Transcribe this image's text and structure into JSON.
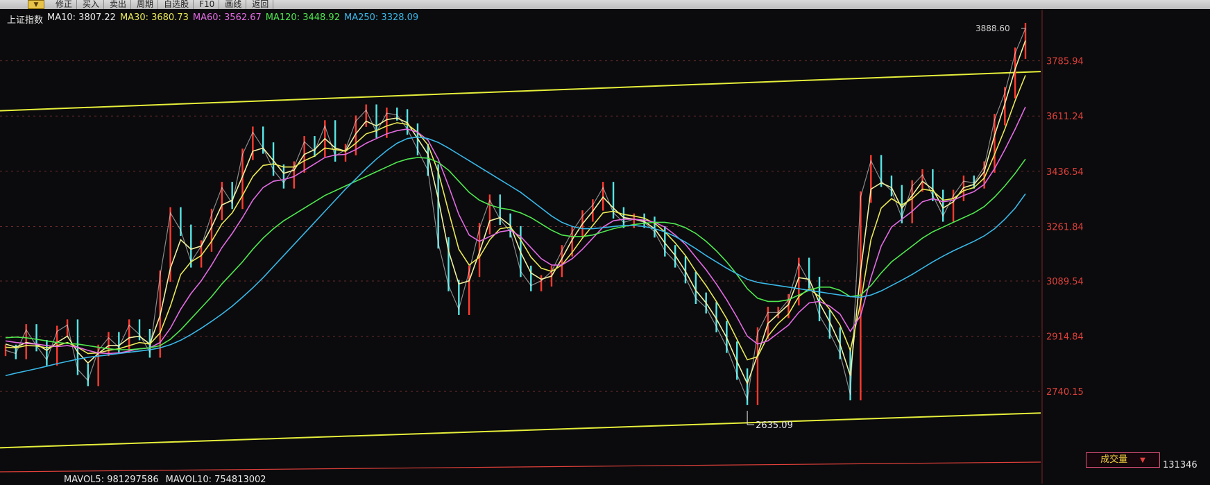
{
  "colors": {
    "up": "#ff3b30",
    "down": "#57e6e6",
    "ma10": "#f0f0a0",
    "ma30": "#e9e957",
    "ma60": "#e46be4",
    "ma120": "#4fe84f",
    "ma250": "#39b8e8",
    "channel": "#e6ef3a",
    "axis_text": "#e0403a"
  },
  "toolbar": {
    "items": [
      "修正",
      "买入",
      "卖出",
      "周期",
      "自选股",
      "F10",
      "画线",
      "返回"
    ]
  },
  "legend": {
    "index_name": "上证指数",
    "ma10": "MA10: 3807.22",
    "ma30": "MA30: 3680.73",
    "ma60": "MA60: 3562.67",
    "ma120": "MA120: 3448.92",
    "ma250": "MA250: 3328.09"
  },
  "chart_data": {
    "type": "line",
    "title": "上证指数",
    "ylim": [
      2600,
      3930
    ],
    "y_ticks": [
      3785.94,
      3611.24,
      3436.54,
      3261.84,
      3089.54,
      2914.84,
      2740.15
    ],
    "y_tick_labels": [
      "3785.94",
      "3611.24",
      "3436.54",
      "3261.84",
      "3089.54",
      "2914.84",
      "2740.15"
    ],
    "annotations": {
      "high": {
        "label": "3888.60",
        "value": 3888.6,
        "index": 99
      },
      "low": {
        "label": "2635.09",
        "value": 2635.09,
        "index": 72
      }
    },
    "grid": true,
    "channel": {
      "upper": [
        [
          0,
          3628
        ],
        [
          99,
          3752
        ]
      ],
      "lower": [
        [
          0,
          2562
        ],
        [
          99,
          2672
        ]
      ]
    },
    "price": [
      2870,
      2860,
      2935,
      2885,
      2840,
      2930,
      2950,
      2810,
      2775,
      2870,
      2910,
      2880,
      2950,
      2920,
      2865,
      3105,
      3305,
      3250,
      3150,
      3200,
      3300,
      3385,
      3335,
      3490,
      3560,
      3510,
      3440,
      3400,
      3450,
      3530,
      3500,
      3580,
      3485,
      3505,
      3595,
      3630,
      3560,
      3620,
      3615,
      3570,
      3505,
      3440,
      3210,
      3075,
      3000,
      3120,
      3255,
      3345,
      3285,
      3245,
      3120,
      3075,
      3090,
      3120,
      3185,
      3245,
      3295,
      3330,
      3385,
      3305,
      3275,
      3285,
      3275,
      3245,
      3185,
      3150,
      3100,
      3035,
      3005,
      2945,
      2880,
      2795,
      2715,
      2925,
      2990,
      2990,
      3030,
      3145,
      3085,
      2980,
      2925,
      2860,
      2730,
      3355,
      3470,
      3405,
      3375,
      3290,
      3390,
      3425,
      3360,
      3295,
      3360,
      3405,
      3400,
      3450,
      3600,
      3685,
      3810,
      3888
    ],
    "series": [
      {
        "name": "MA10",
        "values": [
          2890,
          2880,
          2895,
          2890,
          2870,
          2895,
          2915,
          2865,
          2830,
          2860,
          2885,
          2885,
          2910,
          2915,
          2890,
          2980,
          3130,
          3220,
          3190,
          3200,
          3260,
          3330,
          3345,
          3420,
          3500,
          3510,
          3470,
          3430,
          3440,
          3490,
          3505,
          3540,
          3510,
          3500,
          3555,
          3595,
          3580,
          3600,
          3605,
          3590,
          3540,
          3490,
          3350,
          3185,
          3080,
          3090,
          3180,
          3280,
          3290,
          3265,
          3180,
          3115,
          3095,
          3105,
          3160,
          3220,
          3270,
          3310,
          3355,
          3320,
          3290,
          3285,
          3278,
          3255,
          3210,
          3170,
          3120,
          3060,
          3020,
          2970,
          2910,
          2835,
          2765,
          2855,
          2955,
          2985,
          3015,
          3100,
          3095,
          3020,
          2960,
          2890,
          2790,
          3120,
          3380,
          3400,
          3385,
          3320,
          3360,
          3405,
          3380,
          3320,
          3340,
          3385,
          3395,
          3435,
          3550,
          3650,
          3760,
          3850
        ]
      },
      {
        "name": "MA30",
        "values": [
          2880,
          2878,
          2885,
          2884,
          2878,
          2885,
          2895,
          2880,
          2860,
          2862,
          2870,
          2875,
          2885,
          2895,
          2890,
          2925,
          3010,
          3110,
          3150,
          3170,
          3215,
          3270,
          3305,
          3360,
          3420,
          3455,
          3460,
          3450,
          3450,
          3470,
          3485,
          3510,
          3505,
          3500,
          3525,
          3555,
          3565,
          3580,
          3590,
          3585,
          3560,
          3520,
          3435,
          3310,
          3190,
          3140,
          3165,
          3220,
          3255,
          3260,
          3220,
          3165,
          3130,
          3120,
          3140,
          3180,
          3225,
          3265,
          3305,
          3310,
          3300,
          3295,
          3288,
          3272,
          3245,
          3210,
          3170,
          3120,
          3075,
          3025,
          2970,
          2905,
          2840,
          2850,
          2915,
          2955,
          2985,
          3040,
          3065,
          3040,
          3000,
          2950,
          2870,
          3020,
          3220,
          3320,
          3350,
          3330,
          3350,
          3380,
          3375,
          3345,
          3350,
          3375,
          3385,
          3415,
          3490,
          3570,
          3660,
          3740
        ]
      },
      {
        "name": "MA60",
        "values": [
          2900,
          2895,
          2892,
          2890,
          2885,
          2882,
          2885,
          2880,
          2870,
          2862,
          2860,
          2862,
          2868,
          2875,
          2878,
          2895,
          2940,
          3000,
          3050,
          3090,
          3140,
          3195,
          3240,
          3290,
          3345,
          3385,
          3405,
          3410,
          3420,
          3440,
          3460,
          3480,
          3488,
          3490,
          3505,
          3525,
          3540,
          3555,
          3565,
          3570,
          3560,
          3535,
          3475,
          3390,
          3300,
          3235,
          3215,
          3230,
          3245,
          3250,
          3230,
          3195,
          3160,
          3140,
          3140,
          3160,
          3190,
          3225,
          3260,
          3280,
          3285,
          3285,
          3282,
          3275,
          3260,
          3235,
          3205,
          3165,
          3125,
          3080,
          3030,
          2975,
          2915,
          2890,
          2900,
          2925,
          2950,
          2990,
          3020,
          3025,
          3010,
          2985,
          2930,
          2980,
          3100,
          3200,
          3260,
          3285,
          3310,
          3340,
          3350,
          3340,
          3345,
          3360,
          3372,
          3395,
          3445,
          3505,
          3570,
          3640
        ]
      },
      {
        "name": "MA120",
        "values": [
          2910,
          2912,
          2910,
          2905,
          2900,
          2895,
          2892,
          2890,
          2885,
          2880,
          2875,
          2872,
          2872,
          2875,
          2878,
          2885,
          2905,
          2935,
          2970,
          3005,
          3040,
          3080,
          3115,
          3150,
          3190,
          3225,
          3255,
          3280,
          3300,
          3320,
          3340,
          3360,
          3375,
          3390,
          3405,
          3420,
          3435,
          3450,
          3465,
          3475,
          3480,
          3478,
          3465,
          3440,
          3405,
          3370,
          3345,
          3330,
          3320,
          3315,
          3305,
          3290,
          3270,
          3250,
          3235,
          3230,
          3230,
          3235,
          3245,
          3255,
          3262,
          3268,
          3272,
          3275,
          3275,
          3270,
          3258,
          3240,
          3215,
          3185,
          3150,
          3110,
          3065,
          3035,
          3025,
          3025,
          3030,
          3045,
          3060,
          3070,
          3070,
          3060,
          3040,
          3045,
          3075,
          3115,
          3150,
          3175,
          3200,
          3225,
          3245,
          3260,
          3275,
          3290,
          3305,
          3325,
          3355,
          3390,
          3430,
          3475
        ]
      },
      {
        "name": "MA250",
        "values": [
          2790,
          2798,
          2805,
          2812,
          2820,
          2828,
          2835,
          2842,
          2848,
          2852,
          2856,
          2860,
          2864,
          2868,
          2872,
          2878,
          2888,
          2902,
          2920,
          2940,
          2962,
          2985,
          3010,
          3038,
          3068,
          3100,
          3135,
          3170,
          3205,
          3240,
          3275,
          3310,
          3345,
          3380,
          3412,
          3445,
          3475,
          3502,
          3525,
          3540,
          3545,
          3540,
          3528,
          3510,
          3490,
          3470,
          3450,
          3430,
          3410,
          3390,
          3370,
          3345,
          3320,
          3295,
          3275,
          3262,
          3255,
          3255,
          3258,
          3262,
          3265,
          3265,
          3262,
          3255,
          3245,
          3230,
          3212,
          3192,
          3170,
          3150,
          3130,
          3112,
          3095,
          3085,
          3080,
          3075,
          3070,
          3065,
          3060,
          3055,
          3050,
          3045,
          3040,
          3038,
          3045,
          3058,
          3075,
          3092,
          3110,
          3130,
          3150,
          3168,
          3185,
          3200,
          3215,
          3232,
          3255,
          3285,
          3320,
          3365
        ]
      }
    ]
  },
  "volume": {
    "label": "成交量",
    "value": "131346",
    "mavol5": "MAVOL5: 981297586",
    "mavol10": "MAVOL10: 754813002"
  }
}
